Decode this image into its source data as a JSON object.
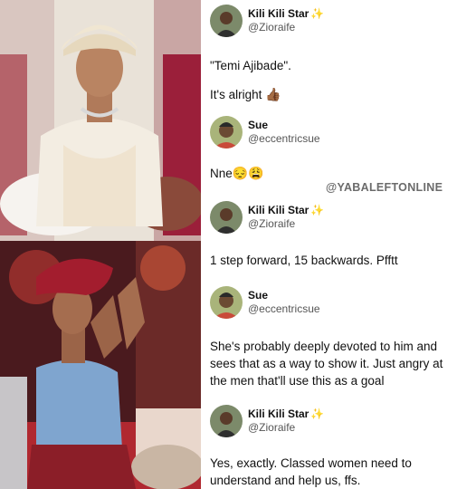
{
  "watermark": "@YABALEFTONLINE",
  "tweets": [
    {
      "author": "Kili Kili Star",
      "sparkle": "✨",
      "handle": "@Zioraife",
      "lines": [
        "\"Temi Ajibade\".",
        "It's alright"
      ],
      "emoji": "👍🏾"
    },
    {
      "author": "Sue",
      "handle": "@eccentricsue",
      "text": "Nne",
      "emoji": "😔😩"
    },
    {
      "author": "Kili Kili Star",
      "sparkle": "✨",
      "handle": "@Zioraife",
      "text": "1 step forward, 15 backwards. Pfftt"
    },
    {
      "author": "Sue",
      "handle": "@eccentricsue",
      "text": "She's probably deeply devoted to him and sees that as a way to show it. Just angry at the men that'll use this as a goal"
    },
    {
      "author": "Kili Kili Star",
      "sparkle": "✨",
      "handle": "@Zioraife",
      "text": "Yes, exactly. Classed women need to understand and help us, ffs."
    }
  ]
}
